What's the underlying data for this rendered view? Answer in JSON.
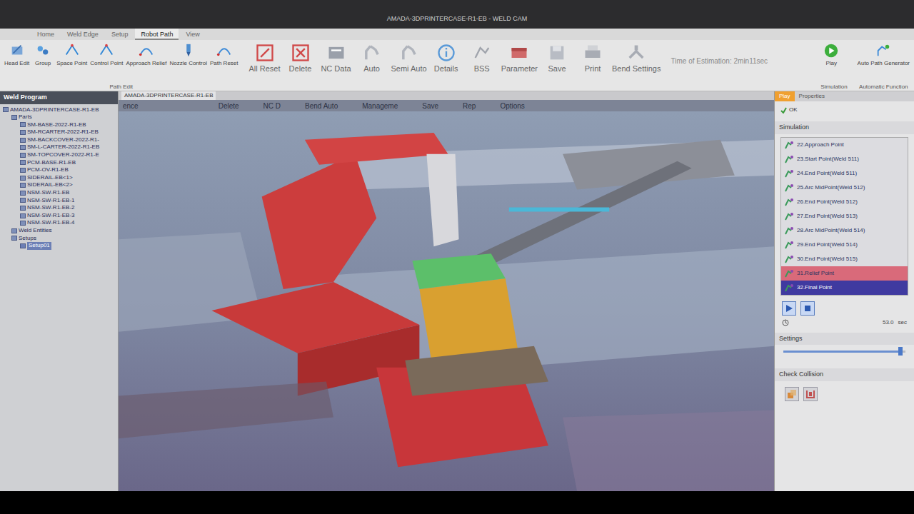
{
  "window": {
    "title": "AMADA-3DPRINTERCASE-R1-EB - WELD CAM"
  },
  "ribbon_tabs": [
    {
      "label": "Home",
      "selected": false
    },
    {
      "label": "Weld Edge",
      "selected": false
    },
    {
      "label": "Setup",
      "selected": false
    },
    {
      "label": "Robot Path",
      "selected": true
    },
    {
      "label": "View",
      "selected": false
    }
  ],
  "ribbon_groups": [
    {
      "label": "Path Edit",
      "buttons": [
        {
          "label": "Head Edit",
          "kind": "edit"
        },
        {
          "label": "Group",
          "kind": "group"
        },
        {
          "label": "Space Point",
          "kind": "point"
        },
        {
          "label": "Control Point",
          "kind": "point"
        },
        {
          "label": "Approach Relief",
          "kind": "path"
        },
        {
          "label": "Nozzle Control",
          "kind": "nozzle"
        },
        {
          "label": "Path Reset",
          "kind": "path"
        }
      ]
    },
    {
      "label": "",
      "buttons": [
        {
          "label": "All Reset",
          "kind": "reset"
        },
        {
          "label": "Delete",
          "kind": "delete"
        },
        {
          "label": "NC Data",
          "kind": "nc"
        },
        {
          "label": "Auto",
          "kind": "auto"
        },
        {
          "label": "Semi Auto",
          "kind": "auto"
        },
        {
          "label": "Details",
          "kind": "info"
        },
        {
          "label": "BSS",
          "kind": "bss"
        },
        {
          "label": "Parameter",
          "kind": "param"
        },
        {
          "label": "Save",
          "kind": "save"
        },
        {
          "label": "Print",
          "kind": "print"
        },
        {
          "label": "Bend Settings",
          "kind": "bend"
        }
      ]
    }
  ],
  "estimation": {
    "label": "Time of Estimation:",
    "value": "2min11sec"
  },
  "ribbon_right": [
    {
      "label": "Play",
      "group": "Simulation",
      "kind": "play"
    },
    {
      "label": "Auto Path Generator",
      "group": "Automatic Function",
      "kind": "autopath"
    }
  ],
  "sidebar": {
    "title": "Weld Program",
    "tree": [
      {
        "label": "AMADA-3DPRINTERCASE-R1-EB",
        "depth": 0,
        "selected": false
      },
      {
        "label": "Parts",
        "depth": 1,
        "selected": false
      },
      {
        "label": "SM-BASE-2022-R1-EB",
        "depth": 2,
        "selected": false
      },
      {
        "label": "SM-RCARTER-2022-R1-EB",
        "depth": 2,
        "selected": false
      },
      {
        "label": "SM-BACKCOVER-2022-R1-",
        "depth": 2,
        "selected": false
      },
      {
        "label": "SM-L-CARTER-2022-R1-EB",
        "depth": 2,
        "selected": false
      },
      {
        "label": "SM-TOPCOVER-2022-R1-E",
        "depth": 2,
        "selected": false
      },
      {
        "label": "PCM-BASE-R1-EB",
        "depth": 2,
        "selected": false
      },
      {
        "label": "PCM-OV-R1-EB",
        "depth": 2,
        "selected": false
      },
      {
        "label": "SIDERAIL-EB<1>",
        "depth": 2,
        "selected": false
      },
      {
        "label": "SIDERAIL-EB<2>",
        "depth": 2,
        "selected": false
      },
      {
        "label": "NSM-SW-R1-EB",
        "depth": 2,
        "selected": false
      },
      {
        "label": "NSM-SW-R1-EB-1",
        "depth": 2,
        "selected": false
      },
      {
        "label": "NSM-SW-R1-EB-2",
        "depth": 2,
        "selected": false
      },
      {
        "label": "NSM-SW-R1-EB-3",
        "depth": 2,
        "selected": false
      },
      {
        "label": "NSM-SW-R1-EB-4",
        "depth": 2,
        "selected": false
      },
      {
        "label": "Weld Entities",
        "depth": 1,
        "selected": false
      },
      {
        "label": "Setups",
        "depth": 1,
        "selected": false
      },
      {
        "label": "Setup01",
        "depth": 2,
        "selected": true
      }
    ]
  },
  "document_tab": "AMADA-3DPRINTERCASE-R1-EB",
  "overlay_toolbar": [
    "ence",
    "Delete",
    "NC D",
    "Bend Auto",
    "Manageme",
    "Save",
    "Rep",
    "Options"
  ],
  "panel": {
    "tabs": [
      {
        "label": "Play",
        "selected": true
      },
      {
        "label": "Properties",
        "selected": false
      }
    ],
    "ok": "OK",
    "section": "Simulation",
    "steps": [
      {
        "label": "22.Approach Point",
        "selected": false
      },
      {
        "label": "23.Start Point(Weld 511)",
        "selected": false
      },
      {
        "label": "24.End Point(Weld 511)",
        "selected": false
      },
      {
        "label": "25.Arc MidPoint(Weld 512)",
        "selected": false
      },
      {
        "label": "26.End Point(Weld 512)",
        "selected": false
      },
      {
        "label": "27.End Point(Weld 513)",
        "selected": false
      },
      {
        "label": "28.Arc MidPoint(Weld 514)",
        "selected": false
      },
      {
        "label": "29.End Point(Weld 514)",
        "selected": false
      },
      {
        "label": "30.End Point(Weld 515)",
        "selected": false
      },
      {
        "label": "31.Relief Point",
        "selected": false
      },
      {
        "label": "32.Final Point",
        "selected": true
      }
    ],
    "time": "53.0",
    "unit": "sec",
    "settings": {
      "title": "Settings",
      "level": 0.96
    },
    "collision": {
      "title": "Check Collision"
    }
  }
}
